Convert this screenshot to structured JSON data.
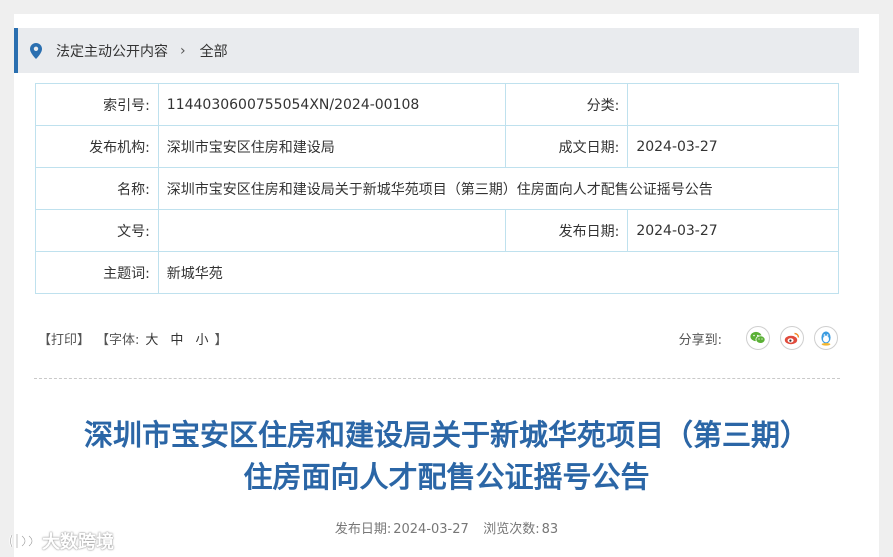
{
  "breadcrumb": {
    "section": "法定主动公开内容",
    "current": "全部",
    "separator": "›"
  },
  "meta": {
    "index_label": "索引号:",
    "index_value": "1144030600755054XN/2024-00108",
    "category_label": "分类:",
    "category_value": "",
    "publisher_label": "发布机构:",
    "publisher_value": "深圳市宝安区住房和建设局",
    "created_label": "成文日期:",
    "created_value": "2024-03-27",
    "name_label": "名称:",
    "name_value": "深圳市宝安区住房和建设局关于新城华苑项目（第三期）住房面向人才配售公证摇号公告",
    "docno_label": "文号:",
    "docno_value": "",
    "pubdate_label": "发布日期:",
    "pubdate_value": "2024-03-27",
    "topic_label": "主题词:",
    "topic_value": "新城华苑"
  },
  "toolbar": {
    "print": "【打印】",
    "font_open": "【字体:",
    "size_large": "大",
    "size_medium": "中",
    "size_small": "小",
    "font_close": "】",
    "share_label": "分享到:"
  },
  "article": {
    "title_line1": "深圳市宝安区住房和建设局关于新城华苑项目（第三期）",
    "title_line2": "住房面向人才配售公证摇号公告",
    "pub_label": "发布日期:",
    "pub_date": "2024-03-27",
    "views_label": "浏览次数:",
    "views": "83"
  },
  "watermark": {
    "text": "大数跨境"
  },
  "colors": {
    "accent": "#2a6fb0",
    "title": "#2b66a6",
    "border": "#bfe1ee",
    "wechat": "#5ab035",
    "weibo": "#e04a3c",
    "qq": "#3a9be0"
  },
  "icons": {
    "location": "location-pin-icon",
    "wechat": "wechat-icon",
    "weibo": "weibo-icon",
    "qq": "qq-icon"
  }
}
